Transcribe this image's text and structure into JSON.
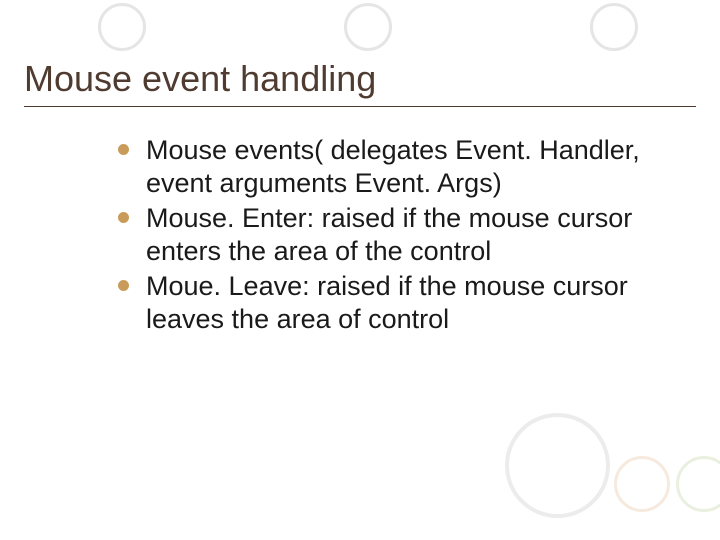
{
  "title": "Mouse event handling",
  "bullets": [
    "Mouse events( delegates Event. Handler, event arguments Event. Args)",
    "Mouse. Enter: raised if the mouse cursor enters the area of the control",
    "Moue. Leave: raised if the mouse cursor leaves the area of control"
  ]
}
